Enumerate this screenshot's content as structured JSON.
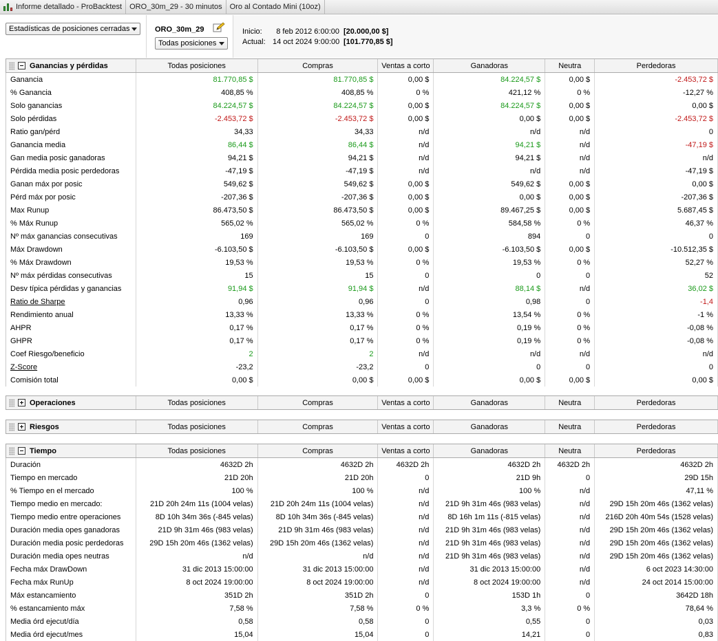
{
  "tabs": [
    "Informe detallado - ProBacktest",
    "ORO_30m_29 - 30 minutos",
    "Oro al Contado Mini (10oz)"
  ],
  "header": {
    "stats_select": "Estadísticas de posiciones cerradas",
    "system_name": "ORO_30m_29",
    "positions_select": "Todas posiciones",
    "inicio_label": "Inicio:",
    "inicio_date": "8 feb 2012 6:00:00",
    "inicio_value": "[20.000,00 $]",
    "actual_label": "Actual:",
    "actual_date": "14 oct 2024 9:00:00",
    "actual_value": "[101.770,85 $]"
  },
  "columns": [
    "Todas posiciones",
    "Compras",
    "Ventas a corto",
    "Ganadoras",
    "Neutra",
    "Perdedoras"
  ],
  "colors": {
    "positive": "#1a9a1a",
    "negative": "#c01818"
  },
  "sections": [
    {
      "title": "Ganancias y pérdidas",
      "expanded": true,
      "rows": [
        {
          "label": "Ganancia",
          "values": [
            "81.770,85 $",
            "81.770,85 $",
            "0,00 $",
            "84.224,57 $",
            "0,00 $",
            "-2.453,72 $"
          ],
          "colors": [
            "pos",
            "pos",
            "",
            "pos",
            "",
            "neg"
          ]
        },
        {
          "label": "% Ganancia",
          "values": [
            "408,85 %",
            "408,85 %",
            "0 %",
            "421,12 %",
            "0 %",
            "-12,27 %"
          ]
        },
        {
          "label": "Solo ganancias",
          "values": [
            "84.224,57 $",
            "84.224,57 $",
            "0,00 $",
            "84.224,57 $",
            "0,00 $",
            "0,00 $"
          ],
          "colors": [
            "pos",
            "pos",
            "",
            "pos",
            "",
            ""
          ]
        },
        {
          "label": "Solo pérdidas",
          "values": [
            "-2.453,72 $",
            "-2.453,72 $",
            "0,00 $",
            "0,00 $",
            "0,00 $",
            "-2.453,72 $"
          ],
          "colors": [
            "neg",
            "neg",
            "",
            "",
            "",
            "neg"
          ]
        },
        {
          "label": "Ratio gan/pérd",
          "values": [
            "34,33",
            "34,33",
            "n/d",
            "n/d",
            "n/d",
            "0"
          ]
        },
        {
          "label": "Ganancia media",
          "values": [
            "86,44 $",
            "86,44 $",
            "n/d",
            "94,21 $",
            "n/d",
            "-47,19 $"
          ],
          "colors": [
            "pos",
            "pos",
            "",
            "pos",
            "",
            "neg"
          ]
        },
        {
          "label": "Gan media posic ganadoras",
          "values": [
            "94,21 $",
            "94,21 $",
            "n/d",
            "94,21 $",
            "n/d",
            "n/d"
          ]
        },
        {
          "label": "Pérdida media posic perdedoras",
          "values": [
            "-47,19 $",
            "-47,19 $",
            "n/d",
            "n/d",
            "n/d",
            "-47,19 $"
          ]
        },
        {
          "label": "Ganan máx por posic",
          "values": [
            "549,62 $",
            "549,62 $",
            "0,00 $",
            "549,62 $",
            "0,00 $",
            "0,00 $"
          ]
        },
        {
          "label": "Pérd máx por posic",
          "values": [
            "-207,36 $",
            "-207,36 $",
            "0,00 $",
            "0,00 $",
            "0,00 $",
            "-207,36 $"
          ]
        },
        {
          "label": "Max Runup",
          "values": [
            "86.473,50 $",
            "86.473,50 $",
            "0,00 $",
            "89.467,25 $",
            "0,00 $",
            "5.687,45 $"
          ]
        },
        {
          "label": "% Máx Runup",
          "values": [
            "565,02 %",
            "565,02 %",
            "0 %",
            "584,58 %",
            "0 %",
            "46,37 %"
          ]
        },
        {
          "label": "Nº máx ganancias consecutivas",
          "values": [
            "169",
            "169",
            "0",
            "894",
            "0",
            "0"
          ]
        },
        {
          "label": "Máx Drawdown",
          "values": [
            "-6.103,50 $",
            "-6.103,50 $",
            "0,00 $",
            "-6.103,50 $",
            "0,00 $",
            "-10.512,35 $"
          ]
        },
        {
          "label": "% Máx Drawdown",
          "values": [
            "19,53 %",
            "19,53 %",
            "0 %",
            "19,53 %",
            "0 %",
            "52,27 %"
          ]
        },
        {
          "label": "Nº máx pérdidas consecutivas",
          "values": [
            "15",
            "15",
            "0",
            "0",
            "0",
            "52"
          ]
        },
        {
          "label": "Desv típica pérdidas y ganancias",
          "values": [
            "91,94 $",
            "91,94 $",
            "n/d",
            "88,14 $",
            "n/d",
            "36,02 $"
          ],
          "colors": [
            "pos",
            "pos",
            "",
            "pos",
            "",
            "pos"
          ]
        },
        {
          "label": "Ratio de Sharpe",
          "underline": true,
          "values": [
            "0,96",
            "0,96",
            "0",
            "0,98",
            "0",
            "-1,4"
          ],
          "colors": [
            "",
            "",
            "",
            "",
            "",
            "neg"
          ]
        },
        {
          "label": "Rendimiento anual",
          "values": [
            "13,33 %",
            "13,33 %",
            "0 %",
            "13,54 %",
            "0 %",
            "-1 %"
          ]
        },
        {
          "label": "AHPR",
          "values": [
            "0,17 %",
            "0,17 %",
            "0 %",
            "0,19 %",
            "0 %",
            "-0,08 %"
          ]
        },
        {
          "label": "GHPR",
          "values": [
            "0,17 %",
            "0,17 %",
            "0 %",
            "0,19 %",
            "0 %",
            "-0,08 %"
          ]
        },
        {
          "label": "Coef Riesgo/beneficio",
          "values": [
            "2",
            "2",
            "n/d",
            "n/d",
            "n/d",
            "n/d"
          ],
          "colors": [
            "pos",
            "pos",
            "",
            "",
            "",
            ""
          ]
        },
        {
          "label": "Z-Score",
          "underline": true,
          "values": [
            "-23,2",
            "-23,2",
            "0",
            "0",
            "0",
            "0"
          ]
        },
        {
          "label": "Comisión total",
          "values": [
            "0,00 $",
            "0,00 $",
            "0,00 $",
            "0,00 $",
            "0,00 $",
            "0,00 $"
          ]
        }
      ]
    },
    {
      "title": "Operaciones",
      "expanded": false,
      "rows": []
    },
    {
      "title": "Riesgos",
      "expanded": false,
      "rows": []
    },
    {
      "title": "Tiempo",
      "expanded": true,
      "rows": [
        {
          "label": "Duración",
          "values": [
            "4632D 2h",
            "4632D 2h",
            "4632D 2h",
            "4632D 2h",
            "4632D 2h",
            "4632D 2h"
          ]
        },
        {
          "label": "Tiempo en mercado",
          "values": [
            "21D 20h",
            "21D 20h",
            "0",
            "21D 9h",
            "0",
            "29D 15h"
          ]
        },
        {
          "label": "% Tiempo en el mercado",
          "values": [
            "100 %",
            "100 %",
            "n/d",
            "100 %",
            "n/d",
            "47,11 %"
          ]
        },
        {
          "label": "Tiempo medio en mercado:",
          "values": [
            "21D 20h 24m 11s (1004 velas)",
            "21D 20h 24m 11s (1004 velas)",
            "n/d",
            "21D 9h 31m 46s (983 velas)",
            "n/d",
            "29D 15h 20m 46s (1362 velas)"
          ]
        },
        {
          "label": "Tiempo medio entre operaciones",
          "values": [
            "8D 10h 34m 36s (-845 velas)",
            "8D 10h 34m 36s (-845 velas)",
            "n/d",
            "8D 16h 1m 11s (-815 velas)",
            "n/d",
            "216D 20h 40m 54s (1528 velas)"
          ]
        },
        {
          "label": "Duración media opes ganadoras",
          "values": [
            "21D 9h 31m 46s (983 velas)",
            "21D 9h 31m 46s (983 velas)",
            "n/d",
            "21D 9h 31m 46s (983 velas)",
            "n/d",
            "29D 15h 20m 46s (1362 velas)"
          ]
        },
        {
          "label": "Duración media posic perdedoras",
          "values": [
            "29D 15h 20m 46s (1362 velas)",
            "29D 15h 20m 46s (1362 velas)",
            "n/d",
            "21D 9h 31m 46s (983 velas)",
            "n/d",
            "29D 15h 20m 46s (1362 velas)"
          ]
        },
        {
          "label": "Duración media opes neutras",
          "values": [
            "n/d",
            "n/d",
            "n/d",
            "21D 9h 31m 46s (983 velas)",
            "n/d",
            "29D 15h 20m 46s (1362 velas)"
          ]
        },
        {
          "label": "Fecha máx DrawDown",
          "values": [
            "31 dic 2013 15:00:00",
            "31 dic 2013 15:00:00",
            "n/d",
            "31 dic 2013 15:00:00",
            "n/d",
            "6 oct 2023 14:30:00"
          ]
        },
        {
          "label": "Fecha máx RunUp",
          "values": [
            "8 oct 2024 19:00:00",
            "8 oct 2024 19:00:00",
            "n/d",
            "8 oct 2024 19:00:00",
            "n/d",
            "24 oct 2014 15:00:00"
          ]
        },
        {
          "label": "Máx estancamiento",
          "values": [
            "351D 2h",
            "351D 2h",
            "0",
            "153D 1h",
            "0",
            "3642D 18h"
          ]
        },
        {
          "label": "% estancamiento máx",
          "values": [
            "7,58 %",
            "7,58 %",
            "0 %",
            "3,3 %",
            "0 %",
            "78,64 %"
          ]
        },
        {
          "label": "Media órd ejecut/día",
          "values": [
            "0,58",
            "0,58",
            "0",
            "0,55",
            "0",
            "0,03"
          ]
        },
        {
          "label": "Media órd ejecut/mes",
          "values": [
            "15,04",
            "15,04",
            "0",
            "14,21",
            "0",
            "0,83"
          ]
        }
      ]
    }
  ]
}
